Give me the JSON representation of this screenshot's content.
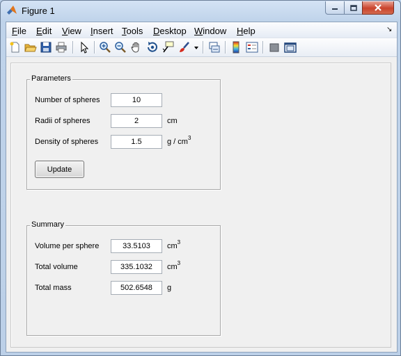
{
  "window": {
    "title": "Figure 1"
  },
  "menu": [
    "File",
    "Edit",
    "View",
    "Insert",
    "Tools",
    "Desktop",
    "Window",
    "Help"
  ],
  "menu_mnemonic_rest": [
    "ile",
    "dit",
    "iew",
    "nsert",
    "ools",
    "esktop",
    "indow",
    "elp"
  ],
  "menu_mnemonic_first": [
    "F",
    "E",
    "V",
    "I",
    "T",
    "D",
    "W",
    "H"
  ],
  "toolbar": [
    "new-figure-icon",
    "open-file-icon",
    "save-icon",
    "print-icon",
    "pointer-icon",
    "zoom-in-icon",
    "zoom-out-icon",
    "pan-icon",
    "rotate-3d-icon",
    "data-cursor-icon",
    "brush-icon",
    "link-plot-icon",
    "colorbar-icon",
    "legend-icon",
    "hide-plot-tools-icon",
    "show-plot-tools-icon"
  ],
  "parameters": {
    "title": "Parameters",
    "num_spheres_label": "Number of spheres",
    "num_spheres_value": "10",
    "radii_label": "Radii of spheres",
    "radii_value": "2",
    "radii_unit": "cm",
    "density_label": "Density of spheres",
    "density_value": "1.5",
    "density_unit": "g / cm",
    "density_unit_sup": "3",
    "update_label": "Update"
  },
  "summary": {
    "title": "Summary",
    "volume_label": "Volume per sphere",
    "volume_value": "33.5103",
    "volume_unit": "cm",
    "volume_unit_sup": "3",
    "total_volume_label": "Total volume",
    "total_volume_value": "335.1032",
    "total_volume_unit": "cm",
    "total_volume_unit_sup": "3",
    "total_mass_label": "Total mass",
    "total_mass_value": "502.6548",
    "total_mass_unit": "g"
  }
}
